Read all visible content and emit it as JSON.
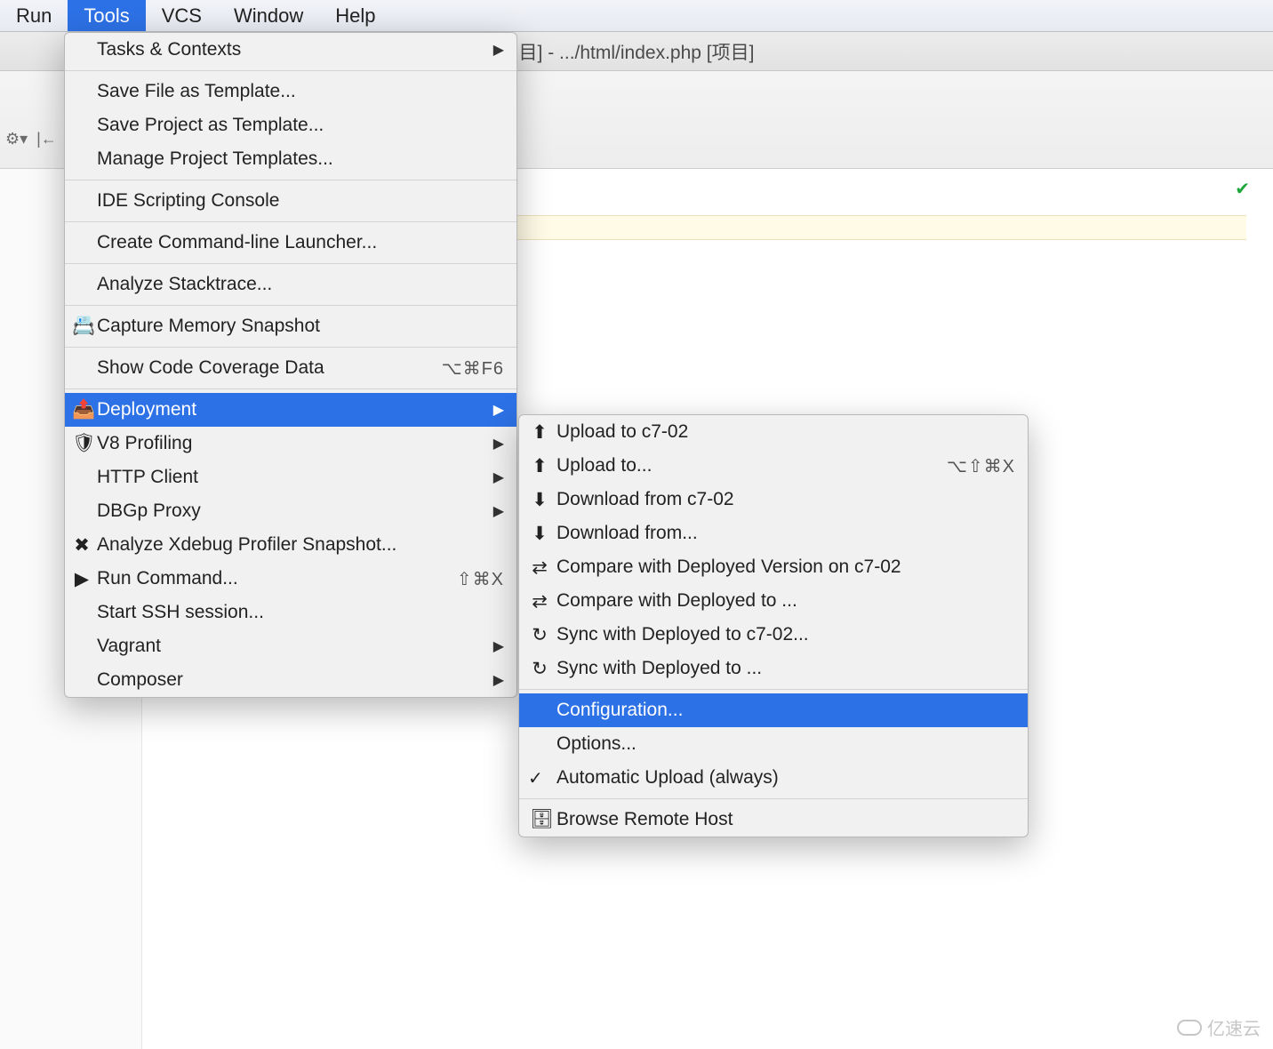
{
  "menubar": {
    "items": [
      "Run",
      "Tools",
      "VCS",
      "Window",
      "Help"
    ],
    "selected": 1
  },
  "title": "目] - .../html/index.php [项目]",
  "tools_menu": {
    "groups": [
      [
        {
          "label": "Tasks & Contexts",
          "arrow": true
        }
      ],
      [
        {
          "label": "Save File as Template..."
        },
        {
          "label": "Save Project as Template..."
        },
        {
          "label": "Manage Project Templates..."
        }
      ],
      [
        {
          "label": "IDE Scripting Console"
        }
      ],
      [
        {
          "label": "Create Command-line Launcher..."
        }
      ],
      [
        {
          "label": "Analyze Stacktrace..."
        }
      ],
      [
        {
          "icon": "📇",
          "label": "Capture Memory Snapshot"
        }
      ],
      [
        {
          "label": "Show Code Coverage Data",
          "shortcut": "⌥⌘F6"
        }
      ],
      [
        {
          "icon": "📤",
          "label": "Deployment",
          "arrow": true,
          "selected": true
        },
        {
          "icon": "🛡",
          "label": "V8 Profiling",
          "arrow": true
        },
        {
          "label": "HTTP Client",
          "arrow": true
        },
        {
          "label": "DBGp Proxy",
          "arrow": true
        },
        {
          "icon": "✖",
          "label": "Analyze Xdebug Profiler Snapshot..."
        },
        {
          "icon": "▶",
          "label": "Run Command...",
          "shortcut": "⇧⌘X"
        },
        {
          "label": "Start SSH session..."
        },
        {
          "label": "Vagrant",
          "arrow": true
        },
        {
          "label": "Composer",
          "arrow": true
        }
      ]
    ]
  },
  "deployment_submenu": {
    "groups": [
      [
        {
          "icon": "⬆",
          "label": "Upload to c7-02"
        },
        {
          "icon": "⬆",
          "label": "Upload to...",
          "shortcut": "⌥⇧⌘X"
        },
        {
          "icon": "⬇",
          "label": "Download from c7-02"
        },
        {
          "icon": "⬇",
          "label": "Download from..."
        },
        {
          "icon": "⇄",
          "label": "Compare with Deployed Version on c7-02"
        },
        {
          "icon": "⇄",
          "label": "Compare with Deployed to ..."
        },
        {
          "icon": "↻",
          "label": "Sync with Deployed to c7-02..."
        },
        {
          "icon": "↻",
          "label": "Sync with Deployed to ..."
        }
      ],
      [
        {
          "label": "Configuration...",
          "selected": true
        },
        {
          "label": "Options..."
        },
        {
          "check": true,
          "label": "Automatic Upload (always)"
        }
      ],
      [
        {
          "icon": "🗄",
          "label": "Browse Remote Host"
        }
      ]
    ]
  },
  "watermark": "亿速云"
}
